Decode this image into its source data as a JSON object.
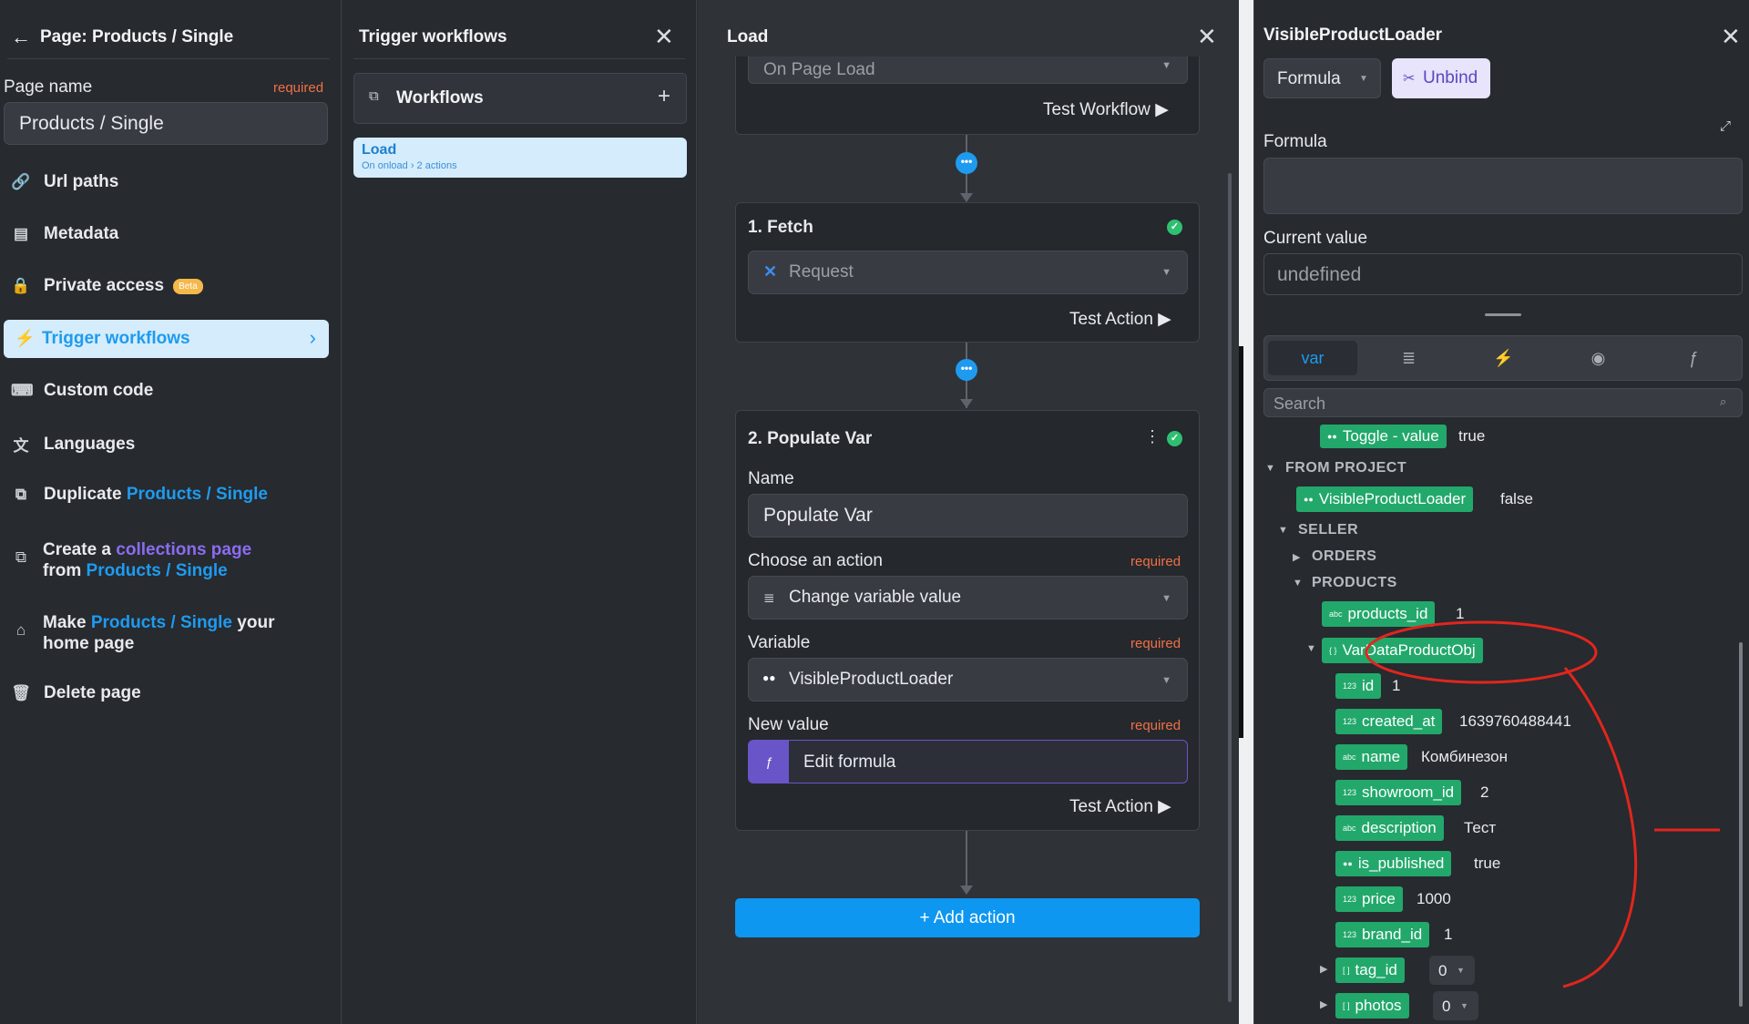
{
  "left_panel": {
    "title": "Page: Products / Single",
    "page_name_label": "Page name",
    "required": "required",
    "page_name_value": "Products / Single",
    "nav": {
      "url_paths": "Url paths",
      "metadata": "Metadata",
      "private_access": "Private access",
      "beta": "Beta",
      "trigger_workflows": "Trigger workflows",
      "custom_code": "Custom code",
      "languages": "Languages",
      "duplicate": "Duplicate",
      "duplicate_target": "Products / Single",
      "create_a": "Create a",
      "collections_page": "collections page",
      "from": "from",
      "from_target": "Products / Single",
      "make": "Make",
      "make_target": "Products / Single",
      "your": "your",
      "home_page": "home page",
      "delete_page": "Delete page"
    }
  },
  "workflows_panel": {
    "title": "Trigger workflows",
    "section_label": "Workflows",
    "item_title": "Load",
    "item_sub": "On onload › 2 actions"
  },
  "load_panel": {
    "title": "Load",
    "trigger_value": "On Page Load",
    "test_workflow": "Test Workflow",
    "fetch": {
      "title": "1. Fetch",
      "request": "Request",
      "test_action": "Test Action"
    },
    "populate": {
      "title": "2. Populate Var",
      "name_label": "Name",
      "name_value": "Populate Var",
      "choose_label": "Choose an action",
      "choose_value": "Change variable value",
      "variable_label": "Variable",
      "variable_value": "VisibleProductLoader",
      "new_value_label": "New value",
      "new_value_btn": "Edit formula",
      "required": "required",
      "test_action": "Test Action"
    },
    "add_action": "+ Add action"
  },
  "right_panel": {
    "title": "VisibleProductLoader",
    "formula_dropdown": "Formula",
    "unbind": "Unbind",
    "formula_label": "Formula",
    "current_value_label": "Current value",
    "current_value": "undefined",
    "tabs": {
      "var": "var"
    },
    "search_placeholder": "Search",
    "tree": {
      "toggle_chip": "Toggle - value",
      "toggle_val": "true",
      "from_project": "FROM PROJECT",
      "vpl_chip": "VisibleProductLoader",
      "vpl_val": "false",
      "seller": "SELLER",
      "orders": "ORDERS",
      "products": "PRODUCTS",
      "products_id": "products_id",
      "products_id_val": "1",
      "vardata": "VarDataProductObj",
      "id": "id",
      "id_val": "1",
      "created_at": "created_at",
      "created_at_val": "1639760488441",
      "name": "name",
      "name_val": "Комбинезон",
      "showroom_id": "showroom_id",
      "showroom_id_val": "2",
      "description": "description",
      "description_val": "Тест",
      "is_published": "is_published",
      "is_published_val": "true",
      "price": "price",
      "price_val": "1000",
      "brand_id": "brand_id",
      "brand_id_val": "1",
      "tag_id": "tag_id",
      "tag_id_val": "0",
      "photos": "photos",
      "photos_val": "0"
    }
  },
  "colors": {
    "accent_blue": "#1e9bf0",
    "green_chip": "#22a86b",
    "annotation_red": "#e0261d",
    "required_orange": "#f07046"
  }
}
